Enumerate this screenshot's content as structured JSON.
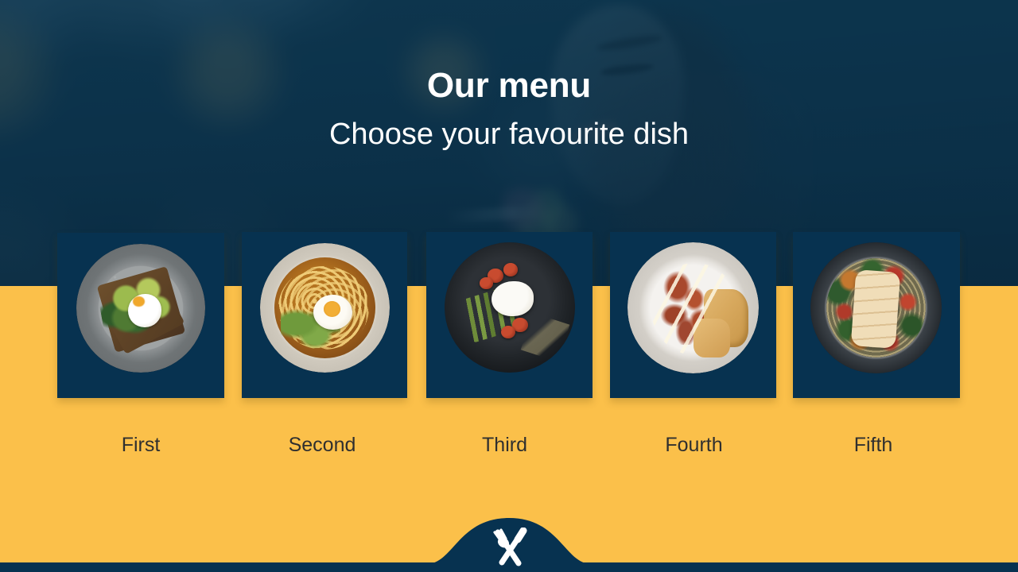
{
  "slide": {
    "title": "Our menu",
    "subtitle": "Choose your favourite dish"
  },
  "colors": {
    "navy": "#073250",
    "yellow": "#fbc04a",
    "label_text": "#2f2f2f",
    "heading_text": "#ffffff",
    "hero_tint": "#0a3048"
  },
  "hero": {
    "image_alt": "woman-eating-photo",
    "icons": [
      "woman-silhouette",
      "bokeh-lights"
    ]
  },
  "menu": {
    "items": [
      {
        "label": "First",
        "dish": "avocado-toast-poached-egg"
      },
      {
        "label": "Second",
        "dish": "ramen-noodle-soup-bowl"
      },
      {
        "label": "Third",
        "dish": "asparagus-egg-tomato-plate"
      },
      {
        "label": "Fourth",
        "dish": "caesar-salad-chicken"
      },
      {
        "label": "Fifth",
        "dish": "grain-bowl-grilled-chicken"
      }
    ]
  },
  "footer": {
    "icon": "fork-and-knife-icon"
  }
}
